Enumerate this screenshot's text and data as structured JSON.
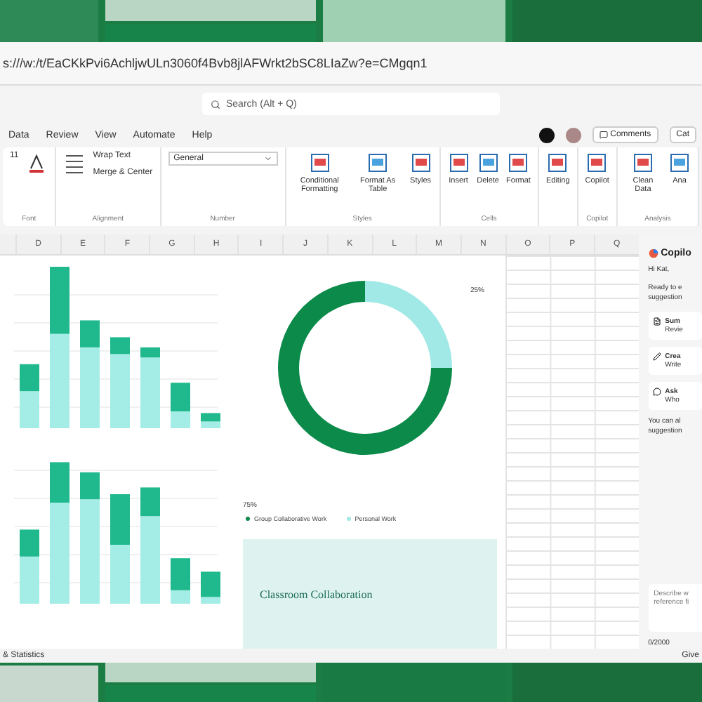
{
  "address_bar": {
    "url": "s:///w:/t/EaCKkPvi6AchljwULn3060f4Bvb8jlAFWrkt2bSC8LIaZw?e=CMgqn1"
  },
  "title_bar": {
    "search": {
      "placeholder": "Search (Alt + Q)"
    }
  },
  "menu": {
    "items": [
      {
        "label": "Data",
        "selected": false
      },
      {
        "label": "Review",
        "selected": false
      },
      {
        "label": "View",
        "selected": false
      },
      {
        "label": "Automate",
        "selected": false
      },
      {
        "label": "Help",
        "selected": false
      }
    ],
    "comments": "Comments",
    "catch_up": "Cat"
  },
  "ribbon": {
    "groups": [
      {
        "kind": "font",
        "name": "Font",
        "size": "11"
      },
      {
        "kind": "alignment",
        "name": "Alignment",
        "wrap": "Wrap Text",
        "merge": "Merge & Center"
      },
      {
        "kind": "number",
        "name": "Number",
        "format": "General"
      },
      {
        "kind": "buttons",
        "name": "Styles",
        "buttons": [
          "Conditional Formatting",
          "Format As Table",
          "Styles"
        ]
      },
      {
        "kind": "buttons",
        "name": "Cells",
        "buttons": [
          "Insert",
          "Delete",
          "Format"
        ]
      },
      {
        "kind": "buttons",
        "buttons": [
          "Editing"
        ]
      },
      {
        "kind": "buttons",
        "name": "Copilot",
        "buttons": [
          "Copilot"
        ]
      },
      {
        "kind": "buttons",
        "name": "Analysis",
        "buttons": [
          "Clean Data",
          "Ana"
        ]
      }
    ]
  },
  "columns": [
    "D",
    "E",
    "F",
    "G",
    "H",
    "I",
    "J",
    "K",
    "L",
    "M",
    "N",
    "O",
    "P",
    "Q"
  ],
  "donut": {
    "chart_data": {
      "type": "donut",
      "categories": [
        "Group Collaborative Work",
        "Personal Work"
      ],
      "values": [
        75,
        25
      ]
    },
    "labels": [
      "25%",
      "75%"
    ]
  },
  "banner": {
    "title": "Classroom Collaboration"
  },
  "copilot": {
    "title": "Copilo",
    "greeting": "Hi Kat,",
    "intro": "Ready to e suggestion",
    "cards": [
      {
        "title": "Sum",
        "text": "Revie"
      },
      {
        "title": "Crea",
        "text": "Write"
      },
      {
        "title": "Ask",
        "text": "Who"
      }
    ],
    "note": "You can al suggestion",
    "input": {
      "placeholder": "Describe w reference fi"
    },
    "counter": "0/2000"
  },
  "status_bar": {
    "left": "& Statistics",
    "right": "Give"
  }
}
